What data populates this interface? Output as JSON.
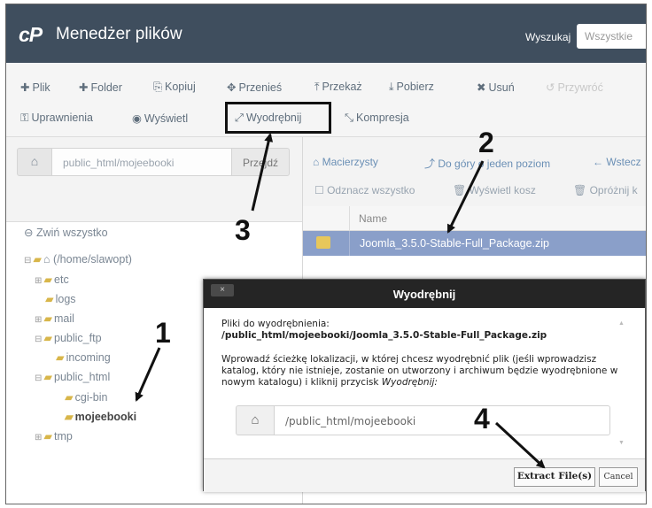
{
  "header": {
    "logo": "cP",
    "title": "Menedżer plików",
    "search_label": "Wyszukaj",
    "search_scope": "Wszystkie"
  },
  "toolbar": {
    "file": "Plik",
    "folder": "Folder",
    "copy": "Kopiuj",
    "move": "Przenieś",
    "upload": "Przekaż",
    "download": "Pobierz",
    "delete": "Usuń",
    "restore": "Przywróć",
    "permissions": "Uprawnienia",
    "view": "Wyświetl",
    "extract": "Wyodrębnij",
    "compress": "Kompresja"
  },
  "pathbar": {
    "path": "public_html/mojeebooki",
    "go": "Przejdź"
  },
  "nav": {
    "home": "Macierzysty",
    "up": "Do góry o jeden poziom",
    "back": "Wstecz",
    "deselect": "Odznacz wszystko",
    "trash": "Wyświetl kosz",
    "empty_trash": "Opróżnij k"
  },
  "tree": {
    "collapse_all": "Zwiń wszystko",
    "root": "(/home/slawopt)",
    "items": [
      "etc",
      "logs",
      "mail",
      "public_ftp",
      "incoming",
      "public_html",
      "cgi-bin",
      "mojeebooki",
      "tmp"
    ]
  },
  "table": {
    "header_name": "Name",
    "selected_file": "Joomla_3.5.0-Stable-Full_Package.zip"
  },
  "dialog": {
    "title": "Wyodrębnij",
    "close": "×",
    "files_label": "Pliki do wyodrębnienia:",
    "file_path": "/public_html/mojeebooki/Joomla_3.5.0-Stable-Full_Package.zip",
    "instructions": "Wprowadź ścieżkę lokalizacji, w której chcesz wyodrębnić plik (jeśli wprowadzisz katalog, który nie istnieje, zostanie on utworzony i archiwum będzie wyodrębnione w nowym katalogu) i kliknij przycisk",
    "instructions_button": "Wyodrębnij:",
    "target_path": "/public_html/mojeebooki",
    "extract_button": "Extract File(s)",
    "cancel_button": "Cancel"
  },
  "annotations": [
    "1",
    "2",
    "3",
    "4"
  ]
}
